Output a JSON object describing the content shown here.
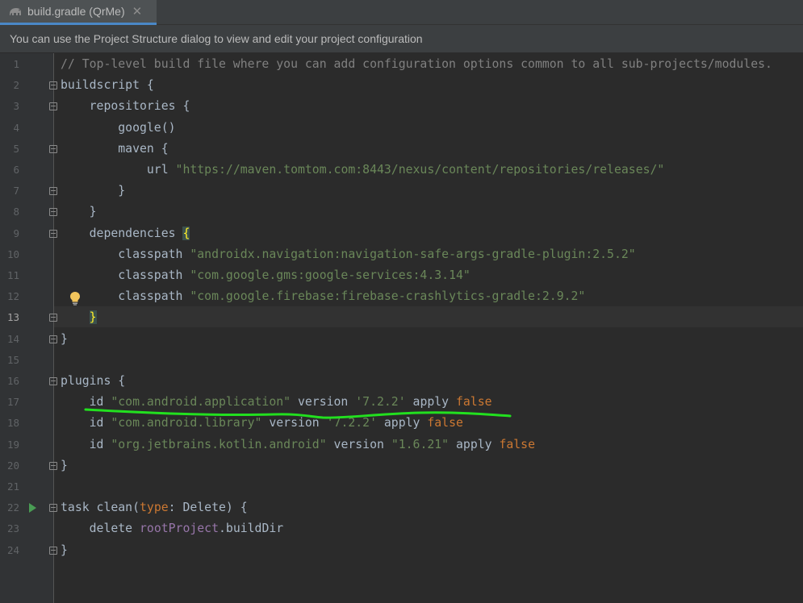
{
  "tab": {
    "title": "build.gradle (QrMe)",
    "close": "✕"
  },
  "banner": {
    "text": "You can use the Project Structure dialog to view and edit your project configuration"
  },
  "colors": {
    "accent": "#4a88c7",
    "annotation_underline": "#22e01f",
    "bulb": "#f2c55c",
    "run": "#499c54"
  },
  "lines": [
    {
      "n": "1",
      "html": "<span class=\"c-comment\">// Top-level build file where you can add configuration options common to all sub-projects/modules.</span>"
    },
    {
      "n": "2",
      "html": "buildscript {"
    },
    {
      "n": "3",
      "html": "    repositories {"
    },
    {
      "n": "4",
      "html": "        google()"
    },
    {
      "n": "5",
      "html": "        maven {"
    },
    {
      "n": "6",
      "html": "            url <span class=\"c-str\">\"https://maven.tomtom.com:8443/nexus/content/repositories/releases/\"</span>"
    },
    {
      "n": "7",
      "html": "        }"
    },
    {
      "n": "8",
      "html": "    }"
    },
    {
      "n": "9",
      "html": "    dependencies <span class=\"brace-match\">{</span>"
    },
    {
      "n": "10",
      "html": "        classpath <span class=\"c-str\">\"androidx.navigation:navigation-safe-args-gradle-plugin:2.5.2\"</span>"
    },
    {
      "n": "11",
      "html": "        classpath <span class=\"c-str\">\"com.google.gms:google-services:4.3.14\"</span>"
    },
    {
      "n": "12",
      "html": "        classpath <span class=\"c-str\">\"com.google.firebase:firebase-crashlytics-gradle:2.9.2\"</span>"
    },
    {
      "n": "13",
      "html": "    <span class=\"brace-match\">}</span>"
    },
    {
      "n": "14",
      "html": "}"
    },
    {
      "n": "15",
      "html": ""
    },
    {
      "n": "16",
      "html": "plugins {"
    },
    {
      "n": "17",
      "html": "    id <span class=\"c-str\">\"com.android.application\"</span> version <span class=\"c-str\">'7.2.2'</span> apply <span class=\"c-kw\">false</span>"
    },
    {
      "n": "18",
      "html": "    id <span class=\"c-str\">\"com.android.library\"</span> version <span class=\"c-str\">'7.2.2'</span> apply <span class=\"c-kw\">false</span>"
    },
    {
      "n": "19",
      "html": "    id <span class=\"c-str\">\"org.jetbrains.kotlin.android\"</span> version <span class=\"c-str\">\"1.6.21\"</span> apply <span class=\"c-kw\">false</span>"
    },
    {
      "n": "20",
      "html": "}"
    },
    {
      "n": "21",
      "html": ""
    },
    {
      "n": "22",
      "html": "task clean(<span class=\"c-kw\">type</span>: Delete) {"
    },
    {
      "n": "23",
      "html": "    delete <span class=\"c-prop\">rootProject</span>.buildDir"
    },
    {
      "n": "24",
      "html": "}"
    }
  ],
  "fold_lines": [
    "2",
    "3",
    "5",
    "7",
    "8",
    "9",
    "13",
    "14",
    "16",
    "20",
    "22",
    "24"
  ],
  "current_line": "13"
}
